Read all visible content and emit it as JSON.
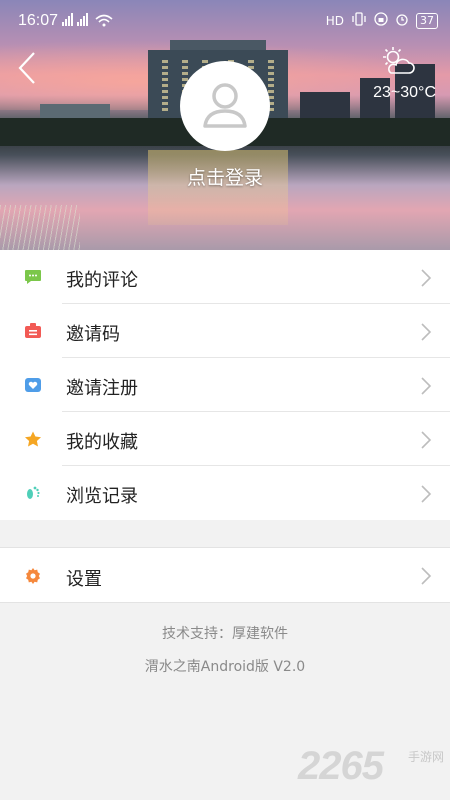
{
  "statusbar": {
    "time": "16:07",
    "signal_text": "ᵀ ···",
    "network_text": "HD",
    "battery": "37"
  },
  "header": {
    "weather_temp": "23~30°C",
    "weather_icon": "partly-cloudy-icon",
    "login_label": "点击登录"
  },
  "menu": {
    "items": [
      {
        "label": "我的评论",
        "icon": "comment-icon",
        "color": "#7bc74a"
      },
      {
        "label": "邀请码",
        "icon": "invite-code-icon",
        "color": "#f25a55"
      },
      {
        "label": "邀请注册",
        "icon": "invite-register-icon",
        "color": "#4f9de8"
      },
      {
        "label": "我的收藏",
        "icon": "star-icon",
        "color": "#f5a623"
      },
      {
        "label": "浏览记录",
        "icon": "footprint-icon",
        "color": "#4fcfb8"
      }
    ],
    "settings": {
      "label": "设置",
      "icon": "gear-icon",
      "color": "#f5883c"
    }
  },
  "footer": {
    "support": "技术支持：厚建软件",
    "version": "渭水之南Android版 V2.0"
  },
  "watermark": {
    "number": "2265",
    "text": "手游网"
  }
}
